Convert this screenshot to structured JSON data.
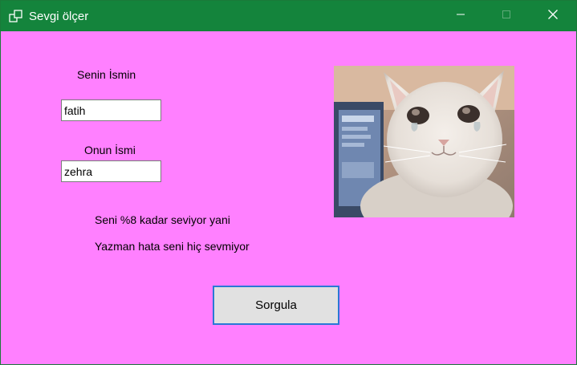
{
  "window": {
    "title": "Sevgi ölçer",
    "titlebar_color": "#14843c",
    "background_color": "#ff80ff",
    "controls": {
      "minimize_icon": "minimize-icon",
      "maximize_icon": "maximize-icon",
      "close_icon": "close-icon"
    }
  },
  "form": {
    "name1_label": "Senin İsmin",
    "name1_value": "fatih",
    "name2_label": "Onun İsmi",
    "name2_value": "zehra",
    "result_line1": "Seni %8 kadar seviyor yani",
    "result_line2": "Yazman hata seni hiç sevmiyor",
    "query_button": "Sorgula",
    "button_border_color": "#2a78d6"
  },
  "image": {
    "subject": "crying-cat-photo"
  }
}
